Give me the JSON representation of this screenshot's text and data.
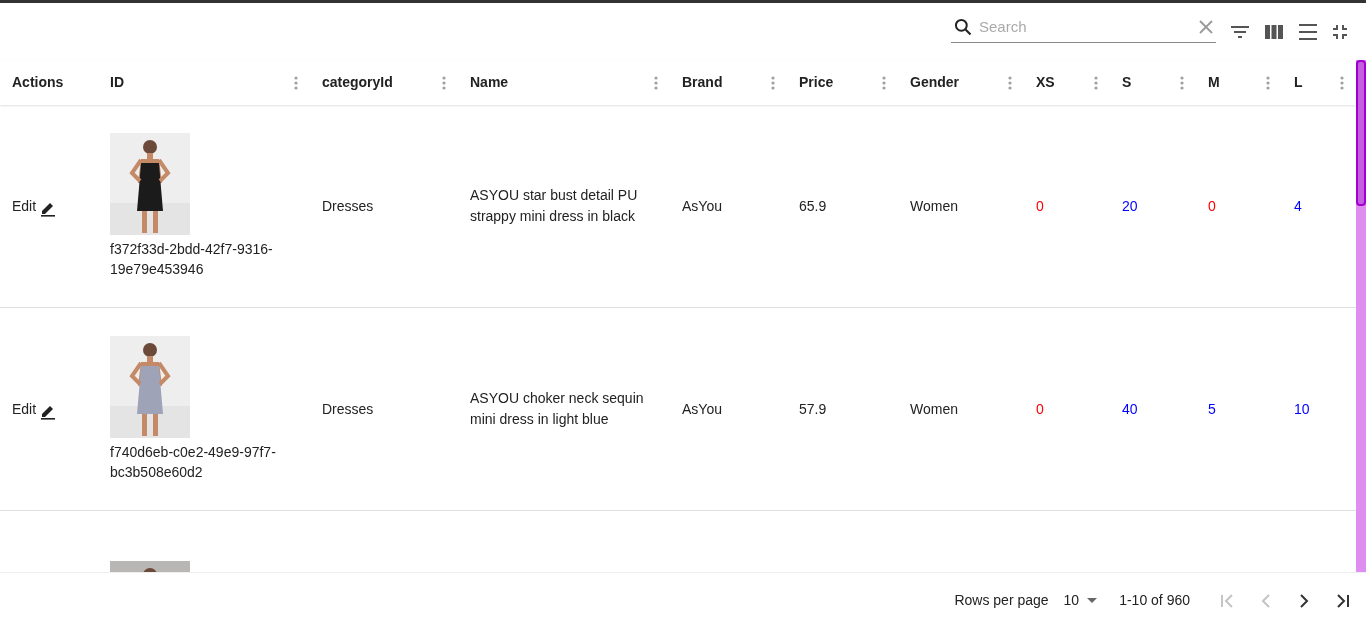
{
  "toolbar": {
    "search": {
      "placeholder": "Search"
    }
  },
  "columns": [
    "Actions",
    "ID",
    "categoryId",
    "Name",
    "Brand",
    "Price",
    "Gender",
    "XS",
    "S",
    "M",
    "L"
  ],
  "rows": [
    {
      "action": "Edit",
      "image": {
        "kind": "picture"
      },
      "id": "f372f33d-2bdd-42f7-9316-19e79e453946",
      "category": "Dresses",
      "name": "ASYOU star bust detail PU strappy mini dress in black",
      "brand": "AsYou",
      "price": "65.9",
      "gender": "Women",
      "stock": [
        {
          "value": "0",
          "color": "#ff0000"
        },
        {
          "value": "20",
          "color": "#0000ff"
        },
        {
          "value": "0",
          "color": "#ff0000"
        },
        {
          "value": "4",
          "color": "#0000ff"
        }
      ]
    },
    {
      "action": "Edit",
      "image": {
        "kind": "picture"
      },
      "id": "f740d6eb-c0e2-49e9-97f7-bc3b508e60d2",
      "category": "Dresses",
      "name": "ASYOU choker neck sequin mini dress in light blue",
      "brand": "AsYou",
      "price": "57.9",
      "gender": "Women",
      "stock": [
        {
          "value": "0",
          "color": "#ff0000"
        },
        {
          "value": "40",
          "color": "#0000ff"
        },
        {
          "value": "5",
          "color": "#0000ff"
        },
        {
          "value": "10",
          "color": "#0000ff"
        }
      ]
    },
    {
      "image": {
        "kind": "picture"
      }
    }
  ],
  "pagination": {
    "rows_per_page_label": "Rows per page",
    "rows_per_page": "10",
    "range": "1-10 of 960",
    "first_disabled": true,
    "prev_disabled": true,
    "next_disabled": false,
    "last_disabled": false
  }
}
